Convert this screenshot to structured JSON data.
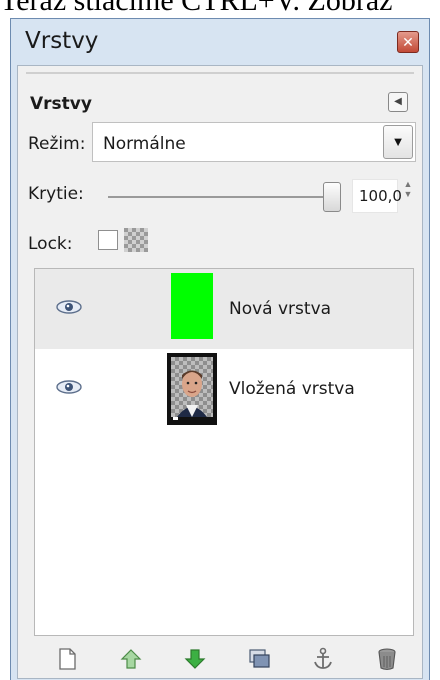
{
  "document_text": "Teraz stlačíme CTRL+V. Zobraz",
  "window": {
    "title": "Vrstvy"
  },
  "panel": {
    "title": "Vrstvy"
  },
  "mode": {
    "label": "Režim:",
    "value": "Normálne"
  },
  "opacity": {
    "label": "Krytie:",
    "value": "100,0",
    "level_percent": 100
  },
  "lock": {
    "label": "Lock:"
  },
  "layers": [
    {
      "name": "Nová vrstva",
      "visible": true,
      "selected": true,
      "thumbnail": "green-fill",
      "thumb_color": "#00ff00"
    },
    {
      "name": "Vložená vrstva",
      "visible": true,
      "selected": false,
      "thumbnail": "portrait-photo"
    }
  ],
  "toolbar": [
    "new-layer-icon",
    "raise-layer-icon",
    "lower-layer-icon",
    "duplicate-layer-icon",
    "anchor-layer-icon",
    "delete-layer-icon"
  ],
  "colors": {
    "window_frame": "#d7e4f2",
    "panel": "#f0f0f0",
    "selection": "#eaeaea",
    "green_accent": "#3cb043"
  }
}
